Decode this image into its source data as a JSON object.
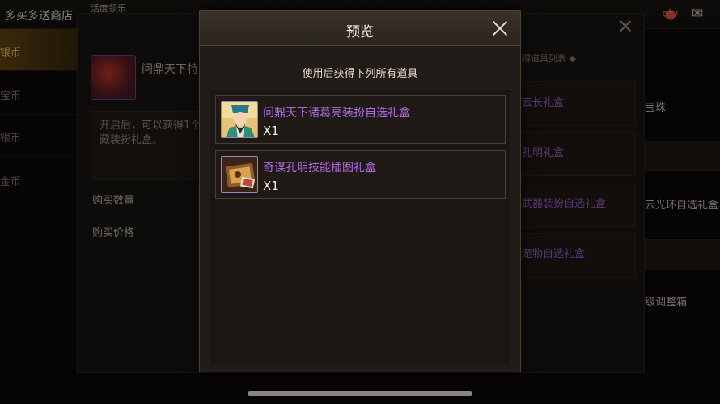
{
  "background": {
    "shop_title": "多买多送商店",
    "sub_title": "活度领乐",
    "nav_items": [
      {
        "label": "银币",
        "active": true
      },
      {
        "label": "宝币",
        "active": false
      },
      {
        "label": "银币",
        "active": false
      },
      {
        "label": "金币",
        "active": false
      }
    ],
    "item_name": "问鼎天下特",
    "item_desc": "开启后，可以获得1个藏装扮礼盒。",
    "buy_quantity_label": "购买数量",
    "buy_price_label": "购买价格",
    "right_header": "得道具列表 ◆",
    "right_rows": [
      "云长礼盒",
      "孔明礼盒",
      "武器装扮自选礼盒",
      "宠物自选礼盒"
    ],
    "far_right_texts": [
      "宝珠",
      "云光环自选礼盒",
      "级调整箱"
    ]
  },
  "modal": {
    "title": "预览",
    "subtitle": "使用后获得下列所有道具",
    "rewards": [
      {
        "name": "问鼎天下诸葛亮装扮自选礼盒",
        "quantity": "X1",
        "icon": "zhuge-liang-portrait-icon"
      },
      {
        "name": "奇谋孔明技能插图礼盒",
        "quantity": "X1",
        "icon": "illustration-gift-box-icon"
      }
    ]
  },
  "colors": {
    "rare_item_purple": "#b06ae0",
    "active_tab_gold": "#ffcc55"
  }
}
